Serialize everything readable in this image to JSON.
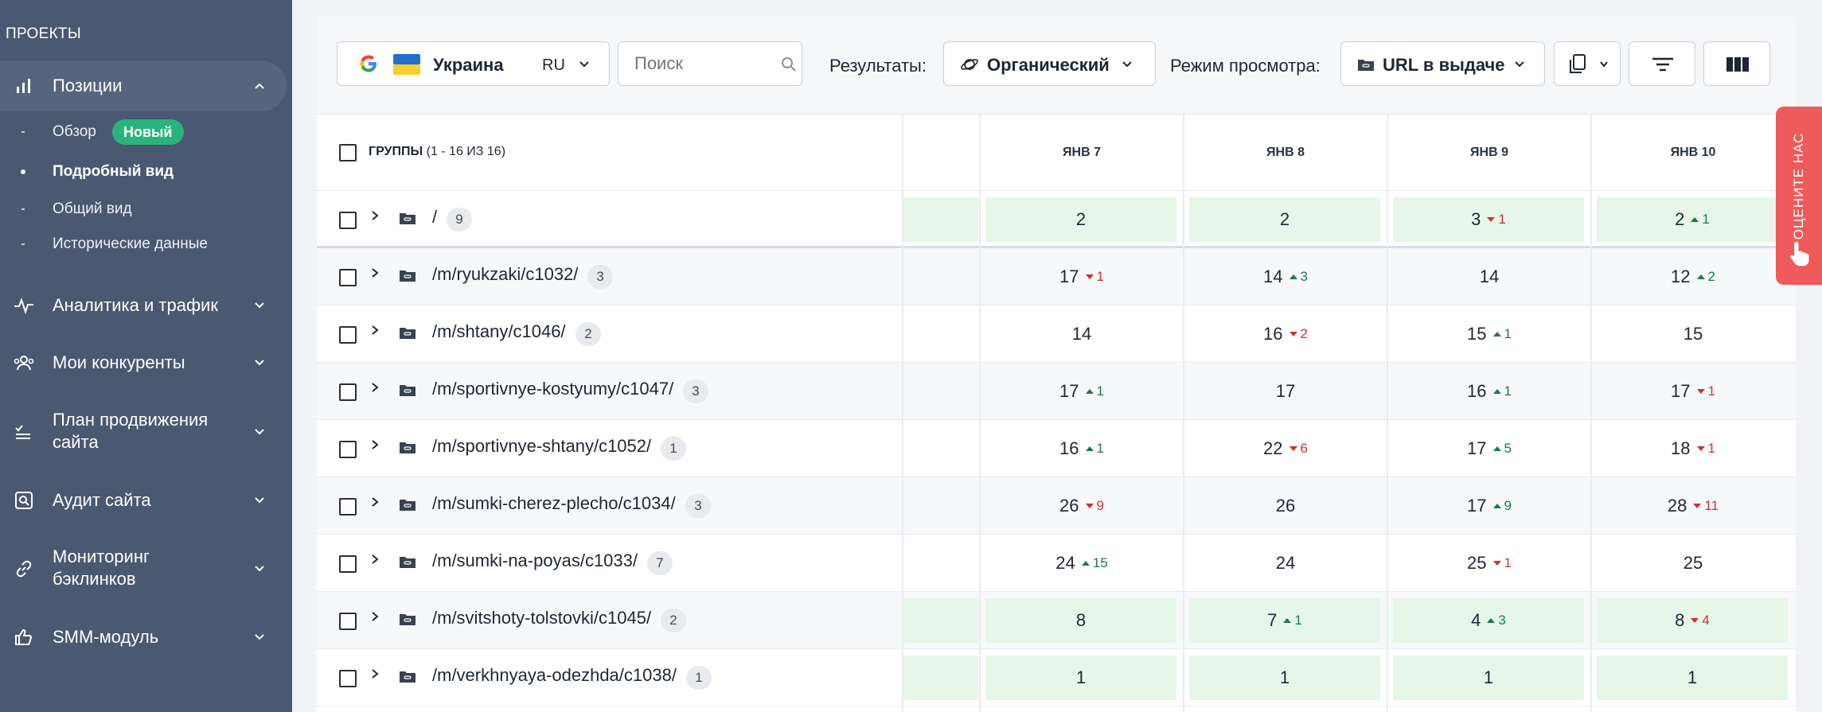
{
  "sidebar": {
    "section_title": "ПРОЕКТЫ",
    "positions": {
      "label": "Позиции",
      "sub": [
        {
          "label": "Обзор",
          "badge": "Новый"
        },
        {
          "label": "Подробный вид"
        },
        {
          "label": "Общий вид"
        },
        {
          "label": "Исторические данные"
        }
      ]
    },
    "items": [
      {
        "label": "Аналитика и трафик",
        "icon": "activity-icon"
      },
      {
        "label": "Мои конкуренты",
        "icon": "users-icon"
      },
      {
        "label": "План продвижения сайта",
        "icon": "checklist-icon"
      },
      {
        "label": "Аудит сайта",
        "icon": "search-doc-icon"
      },
      {
        "label": "Мониторинг бэклинков",
        "icon": "link-icon"
      },
      {
        "label": "SMM-модуль",
        "icon": "thumb-up-icon"
      }
    ]
  },
  "toolbar": {
    "region": "Украина",
    "lang": "RU",
    "search_placeholder": "Поиск",
    "results_label": "Результаты:",
    "results_value": "Органический",
    "view_label": "Режим просмотра:",
    "view_value": "URL в выдаче"
  },
  "table": {
    "groups_label": "ГРУППЫ",
    "groups_count": "(1 - 16 ИЗ 16)",
    "dates": [
      "ЯНВ 7",
      "ЯНВ 8",
      "ЯНВ 9",
      "ЯНВ 10"
    ],
    "rows": [
      {
        "path": "/",
        "count": "9",
        "green": true,
        "cells": [
          {
            "v": "2"
          },
          {
            "v": "2"
          },
          {
            "v": "3",
            "d": "1",
            "dir": "down"
          },
          {
            "v": "2",
            "d": "1",
            "dir": "up"
          }
        ]
      },
      {
        "path": "/m/ryukzaki/c1032/",
        "count": "3",
        "green": false,
        "cells": [
          {
            "v": "17",
            "d": "1",
            "dir": "down"
          },
          {
            "v": "14",
            "d": "3",
            "dir": "up"
          },
          {
            "v": "14"
          },
          {
            "v": "12",
            "d": "2",
            "dir": "up"
          }
        ]
      },
      {
        "path": "/m/shtany/c1046/",
        "count": "2",
        "green": false,
        "cells": [
          {
            "v": "14"
          },
          {
            "v": "16",
            "d": "2",
            "dir": "down"
          },
          {
            "v": "15",
            "d": "1",
            "dir": "up"
          },
          {
            "v": "15"
          }
        ]
      },
      {
        "path": "/m/sportivnye-kostyumy/c1047/",
        "count": "3",
        "green": false,
        "cells": [
          {
            "v": "17",
            "d": "1",
            "dir": "up"
          },
          {
            "v": "17"
          },
          {
            "v": "16",
            "d": "1",
            "dir": "up"
          },
          {
            "v": "17",
            "d": "1",
            "dir": "down"
          }
        ]
      },
      {
        "path": "/m/sportivnye-shtany/c1052/",
        "count": "1",
        "green": false,
        "cells": [
          {
            "v": "16",
            "d": "1",
            "dir": "up"
          },
          {
            "v": "22",
            "d": "6",
            "dir": "down"
          },
          {
            "v": "17",
            "d": "5",
            "dir": "up"
          },
          {
            "v": "18",
            "d": "1",
            "dir": "down"
          }
        ]
      },
      {
        "path": "/m/sumki-cherez-plecho/c1034/",
        "count": "3",
        "green": false,
        "cells": [
          {
            "v": "26",
            "d": "9",
            "dir": "down"
          },
          {
            "v": "26"
          },
          {
            "v": "17",
            "d": "9",
            "dir": "up"
          },
          {
            "v": "28",
            "d": "11",
            "dir": "down"
          }
        ]
      },
      {
        "path": "/m/sumki-na-poyas/c1033/",
        "count": "7",
        "green": false,
        "cells": [
          {
            "v": "24",
            "d": "15",
            "dir": "up"
          },
          {
            "v": "24"
          },
          {
            "v": "25",
            "d": "1",
            "dir": "down"
          },
          {
            "v": "25"
          }
        ]
      },
      {
        "path": "/m/svitshoty-tolstovki/c1045/",
        "count": "2",
        "green": true,
        "cells": [
          {
            "v": "8"
          },
          {
            "v": "7",
            "d": "1",
            "dir": "up"
          },
          {
            "v": "4",
            "d": "3",
            "dir": "up"
          },
          {
            "v": "8",
            "d": "4",
            "dir": "down"
          }
        ]
      },
      {
        "path": "/m/verkhnyaya-odezhda/c1038/",
        "count": "1",
        "green": true,
        "cells": [
          {
            "v": "1"
          },
          {
            "v": "1"
          },
          {
            "v": "1"
          },
          {
            "v": "1"
          }
        ]
      }
    ]
  },
  "rate_tab": "ОЦЕНИТЕ НАС",
  "colors": {
    "sidebar": "#4a5872",
    "badge": "#28b47a",
    "green_cell": "#e6f7ea",
    "up": "#1c7a4a",
    "down": "#d32f2f",
    "rate": "#ef5a5a"
  }
}
